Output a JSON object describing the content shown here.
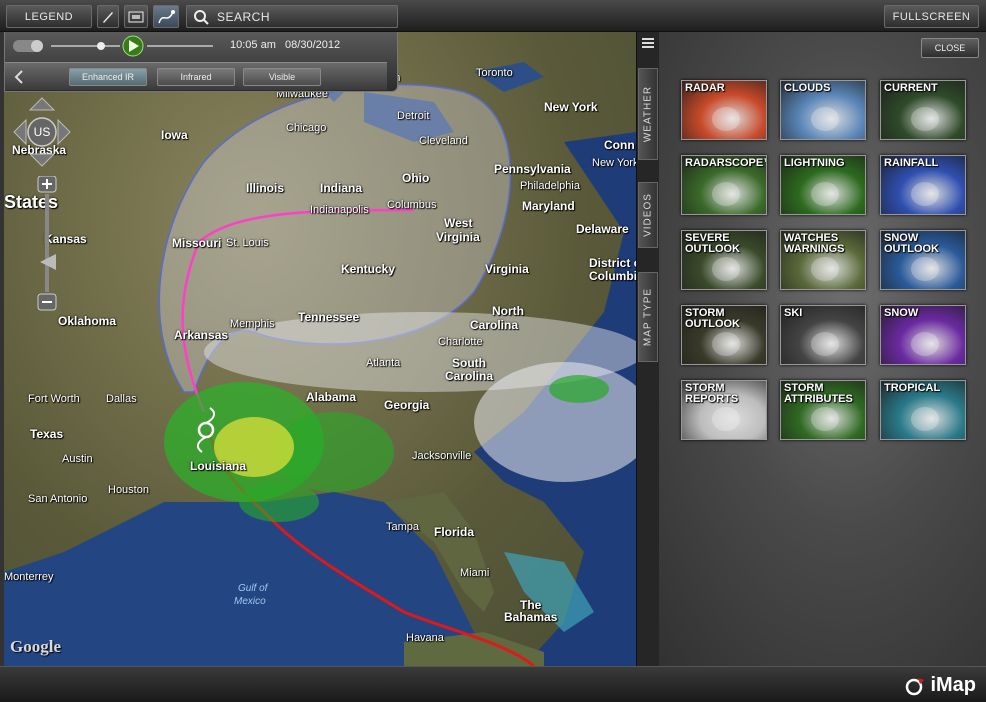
{
  "toolbar": {
    "legend_label": "LEGEND",
    "search_label": "SEARCH",
    "fullscreen_label": "FULLSCREEN"
  },
  "playback": {
    "time": "10:05 am",
    "date": "08/30/2012",
    "tabs": [
      {
        "label": "Enhanced IR",
        "active": true
      },
      {
        "label": "Infrared",
        "active": false
      },
      {
        "label": "Visible",
        "active": false
      }
    ]
  },
  "nav": {
    "center_label": "US"
  },
  "map": {
    "places": [
      {
        "name": "Toronto"
      },
      {
        "name": "Milwaukee"
      },
      {
        "name": "gan"
      },
      {
        "name": "Detroit"
      },
      {
        "name": "New York"
      },
      {
        "name": "Iowa"
      },
      {
        "name": "Chicago"
      },
      {
        "name": "Cleveland"
      },
      {
        "name": "Conn"
      },
      {
        "name": "Nebraska"
      },
      {
        "name": "New York"
      },
      {
        "name": "Pennsylvania"
      },
      {
        "name": "Ohio"
      },
      {
        "name": "Philadelphia"
      },
      {
        "name": "Illinois"
      },
      {
        "name": "Indiana"
      },
      {
        "name": "States"
      },
      {
        "name": "Columbus"
      },
      {
        "name": "Maryland"
      },
      {
        "name": "Indianapolis"
      },
      {
        "name": "West"
      },
      {
        "name": "Virginia"
      },
      {
        "name": "Kansas"
      },
      {
        "name": "Missouri"
      },
      {
        "name": "St. Louis"
      },
      {
        "name": "Delaware"
      },
      {
        "name": "Kentucky"
      },
      {
        "name": "Virginia"
      },
      {
        "name": "District o"
      },
      {
        "name": "Columbi"
      },
      {
        "name": "Oklahoma"
      },
      {
        "name": "Memphis"
      },
      {
        "name": "Tennessee"
      },
      {
        "name": "North"
      },
      {
        "name": "Carolina"
      },
      {
        "name": "Arkansas"
      },
      {
        "name": "Charlotte"
      },
      {
        "name": "Atlanta"
      },
      {
        "name": "South"
      },
      {
        "name": "Carolina"
      },
      {
        "name": "Fort Worth"
      },
      {
        "name": "Dallas"
      },
      {
        "name": "Alabama"
      },
      {
        "name": "Georgia"
      },
      {
        "name": "Texas"
      },
      {
        "name": "Austin"
      },
      {
        "name": "Louisiana"
      },
      {
        "name": "Jacksonville"
      },
      {
        "name": "San Antonio"
      },
      {
        "name": "Houston"
      },
      {
        "name": "Tampa"
      },
      {
        "name": "Florida"
      },
      {
        "name": "Monterrey"
      },
      {
        "name": "Gulf of"
      },
      {
        "name": "Mexico"
      },
      {
        "name": "Miami"
      },
      {
        "name": "The"
      },
      {
        "name": "Bahamas"
      },
      {
        "name": "Havana"
      }
    ],
    "attribution": "Google"
  },
  "panel": {
    "close_label": "CLOSE",
    "side_tabs": [
      "WEATHER",
      "VIDEOS",
      "MAP TYPE"
    ],
    "tiles": [
      {
        "label": "Radar",
        "color": "#c84a2a",
        "icon": "radar-icon"
      },
      {
        "label": "Clouds",
        "color": "#5a86b8",
        "icon": "clouds-icon"
      },
      {
        "label": "Current",
        "color": "#2f4a2a",
        "icon": "current-conditions-icon"
      },
      {
        "label": "RadarScope™",
        "color": "#3b6a2a",
        "icon": "radarscope-icon"
      },
      {
        "label": "Lightning",
        "color": "#2d6a1f",
        "icon": "lightning-icon"
      },
      {
        "label": "Rainfall",
        "color": "#2f4fb0",
        "icon": "rainfall-icon"
      },
      {
        "label": "Severe Outlook",
        "color": "#3a4a2a",
        "icon": "severe-outlook-icon"
      },
      {
        "label": "Watches Warnings",
        "color": "#5a6a3a",
        "icon": "watches-warnings-icon"
      },
      {
        "label": "Snow Outlook",
        "color": "#2a5a9a",
        "icon": "snow-outlook-icon"
      },
      {
        "label": "Storm Outlook",
        "color": "#3a3a2a",
        "icon": "storm-outlook-icon"
      },
      {
        "label": "Ski",
        "color": "#444444",
        "icon": "ski-icon"
      },
      {
        "label": "Snow",
        "color": "#6a2aa0",
        "icon": "snow-icon"
      },
      {
        "label": "Storm Reports",
        "color": "#bdbdbd",
        "icon": "storm-reports-icon"
      },
      {
        "label": "Storm Attributes",
        "color": "#2f6a22",
        "icon": "storm-attributes-icon"
      },
      {
        "label": "Tropical",
        "color": "#2a7a8a",
        "icon": "tropical-icon"
      }
    ]
  },
  "brand": {
    "name": "iMap"
  }
}
